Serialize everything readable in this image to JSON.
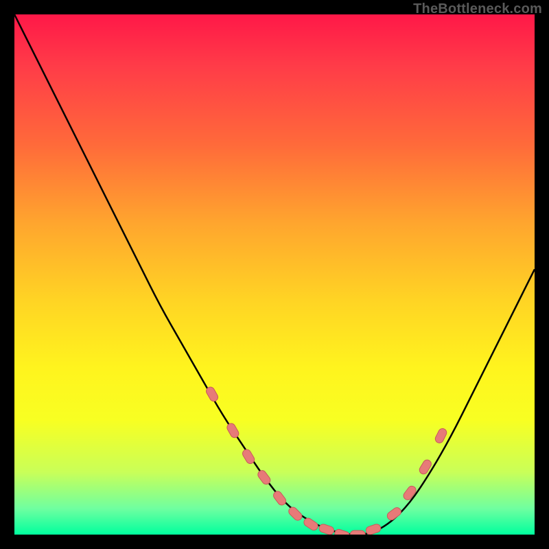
{
  "watermark": "TheBottleneck.com",
  "colors": {
    "page_bg": "#000000",
    "gradient_top": "#ff1848",
    "gradient_bottom": "#00ff9e",
    "curve": "#000000",
    "dot_fill": "#e77a78",
    "dot_stroke": "#c75a5a"
  },
  "chart_data": {
    "type": "line",
    "title": "",
    "xlabel": "",
    "ylabel": "",
    "xlim": [
      0,
      100
    ],
    "ylim": [
      0,
      100
    ],
    "grid": false,
    "legend": false,
    "series": [
      {
        "name": "bottleneck-curve",
        "x": [
          0,
          4,
          8,
          12,
          16,
          20,
          24,
          28,
          32,
          36,
          40,
          44,
          48,
          52,
          56,
          60,
          64,
          68,
          72,
          76,
          80,
          84,
          88,
          92,
          96,
          100
        ],
        "y": [
          100,
          92,
          84,
          76,
          68,
          60,
          52,
          44,
          37,
          30,
          23,
          17,
          11,
          6,
          3,
          1,
          0,
          0,
          2,
          6,
          12,
          19,
          27,
          35,
          43,
          51
        ]
      }
    ],
    "highlight_points": {
      "name": "marked-dots",
      "x": [
        38,
        42,
        45,
        48,
        51,
        54,
        57,
        60,
        63,
        66,
        69,
        73,
        76,
        79,
        82
      ],
      "y": [
        27,
        20,
        15,
        11,
        7,
        4,
        2,
        1,
        0,
        0,
        1,
        4,
        8,
        13,
        19
      ]
    }
  }
}
